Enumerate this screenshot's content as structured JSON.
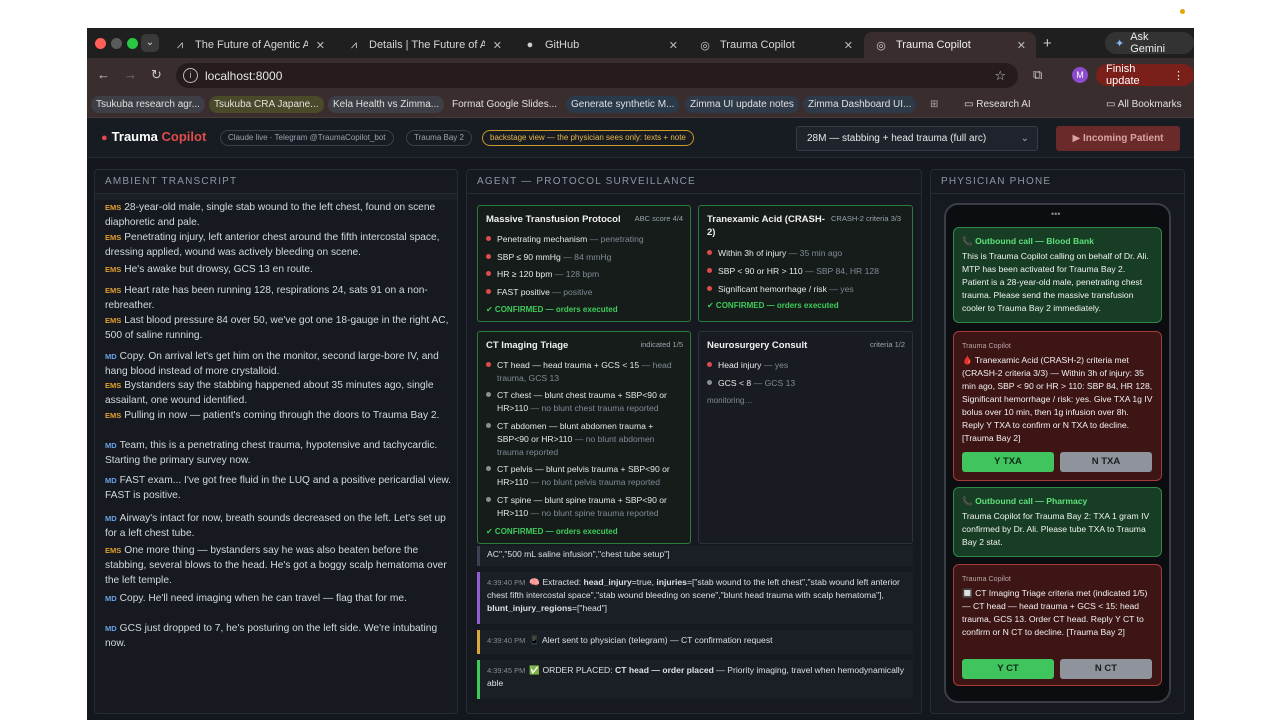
{
  "browser": {
    "tabs": [
      {
        "icon": "agent-icon",
        "title": "The Future of Agentic AI in H",
        "active": false
      },
      {
        "icon": "agent-icon",
        "title": "Details | The Future of Agent",
        "active": false
      },
      {
        "icon": "github-icon",
        "title": "GitHub",
        "active": false
      },
      {
        "icon": "globe-icon",
        "title": "Trauma Copilot",
        "active": false
      },
      {
        "icon": "globe-icon",
        "title": "Trauma Copilot",
        "active": true
      }
    ],
    "ask_gemini": "Ask Gemini",
    "url": "localhost:8000",
    "profile_initial": "M",
    "finish_update": "Finish update",
    "bookmarks": [
      "Tsukuba research agr...",
      "Tsukuba CRA Japane...",
      "Kela Health vs Zimma...",
      "Format Google Slides...",
      "Generate synthetic M...",
      "Zimma UI update notes",
      "Zimma Dashboard UI..."
    ],
    "bookmark_folder": "Research AI",
    "all_bookmarks": "All Bookmarks"
  },
  "header": {
    "brand_1": "Trauma",
    "brand_2": "Copilot",
    "pill_claude": "Claude live · Telegram @TraumaCopilot_bot",
    "pill_bay": "Trauma Bay 2",
    "pill_backstage": "backstage view — the physician sees only: texts + note",
    "scenario": "28M — stabbing + head trauma (full arc)",
    "incoming": "Incoming Patient"
  },
  "transcript": {
    "title": "AMBIENT TRANSCRIPT",
    "lines": [
      {
        "speaker": "EMS",
        "text": "28-year-old male, single stab wound to the left chest, found on scene diaphoretic and pale."
      },
      {
        "speaker": "EMS",
        "text": "Penetrating injury, left anterior chest around the fifth intercostal space, dressing applied, wound was actively bleeding on scene."
      },
      {
        "speaker": "EMS",
        "text": "He's awake but drowsy, GCS 13 en route."
      },
      {
        "speaker": "EMS",
        "text": "Heart rate has been running 128, respirations 24, sats 91 on a non-rebreather."
      },
      {
        "speaker": "EMS",
        "text": "Last blood pressure 84 over 50, we've got one 18-gauge in the right AC, 500 of saline running."
      },
      {
        "speaker": "MD",
        "text": "Copy. On arrival let's get him on the monitor, second large-bore IV, and hang blood instead of more crystalloid."
      },
      {
        "speaker": "EMS",
        "text": "Bystanders say the stabbing happened about 35 minutes ago, single assailant, one wound identified."
      },
      {
        "speaker": "EMS",
        "text": "Pulling in now — patient's coming through the doors to Trauma Bay 2."
      },
      {
        "speaker": "MD",
        "text": "Team, this is a penetrating chest trauma, hypotensive and tachycardic. Starting the primary survey now."
      },
      {
        "speaker": "MD",
        "text": "FAST exam... I've got free fluid in the LUQ and a positive pericardial view. FAST is positive."
      },
      {
        "speaker": "MD",
        "text": "Airway's intact for now, breath sounds decreased on the left. Let's set up for a left chest tube."
      },
      {
        "speaker": "EMS",
        "text": "One more thing — bystanders say he was also beaten before the stabbing, several blows to the head. He's got a boggy scalp hematoma over the left temple."
      },
      {
        "speaker": "MD",
        "text": "Copy. He'll need imaging when he can travel — flag that for me."
      },
      {
        "speaker": "MD",
        "text": "GCS just dropped to 7, he's posturing on the left side. We're intubating now."
      }
    ]
  },
  "agent": {
    "title": "AGENT — PROTOCOL SURVEILLANCE",
    "cards": [
      {
        "title": "Massive Transfusion Protocol",
        "score": "ABC score 4/4",
        "criteria": [
          {
            "label": "Penetrating mechanism",
            "note": "— penetrating"
          },
          {
            "label": "SBP ≤ 90 mmHg",
            "note": "— 84 mmHg"
          },
          {
            "label": "HR ≥ 120 bpm",
            "note": "— 128 bpm"
          },
          {
            "label": "FAST positive",
            "note": "— positive"
          }
        ],
        "status": "✔ CONFIRMED — orders executed"
      },
      {
        "title": "Tranexamic Acid (CRASH-2)",
        "score": "CRASH-2 criteria 3/3",
        "criteria": [
          {
            "label": "Within 3h of injury",
            "note": "— 35 min ago"
          },
          {
            "label": "SBP < 90 or HR > 110",
            "note": "— SBP 84, HR 128"
          },
          {
            "label": "Significant hemorrhage / risk",
            "note": "— yes"
          }
        ],
        "status": "✔ CONFIRMED — orders executed"
      },
      {
        "title": "CT Imaging Triage",
        "score": "indicated 1/5",
        "criteria": [
          {
            "label": "CT head — head trauma + GCS < 15",
            "note": "— head trauma, GCS 13"
          },
          {
            "label": "CT chest — blunt chest trauma + SBP<90 or HR>110",
            "note": "— no blunt chest trauma reported"
          },
          {
            "label": "CT abdomen — blunt abdomen trauma + SBP<90 or HR>110",
            "note": "— no blunt abdomen trauma reported"
          },
          {
            "label": "CT pelvis — blunt pelvis trauma + SBP<90 or HR>110",
            "note": "— no blunt pelvis trauma reported"
          },
          {
            "label": "CT spine — blunt spine trauma + SBP<90 or HR>110",
            "note": "— no blunt spine trauma reported"
          }
        ],
        "status": "✔ CONFIRMED — orders executed"
      },
      {
        "title": "Neurosurgery Consult",
        "score": "criteria 1/2",
        "criteria": [
          {
            "label": "Head injury",
            "note": "— yes"
          },
          {
            "label": "GCS < 8",
            "note": "— GCS 13"
          }
        ],
        "status": "monitoring…"
      }
    ],
    "log": [
      {
        "ts": "",
        "text": "AC\",\"500 mL saline infusion\",\"chest tube setup\"]"
      },
      {
        "ts": "4:39:40 PM",
        "pre": "🧠 Extracted: ",
        "k1": "head_injury",
        "t1": "=true, ",
        "k2": "injuries",
        "t2": "=[\"stab wound to the left chest\",\"stab wound left anterior chest fifth intercostal space\",\"stab wound bleeding on scene\",\"blunt head trauma with scalp hematoma\"], ",
        "k3": "blunt_injury_regions",
        "t3": "=[\"head\"]"
      },
      {
        "ts": "4:39:40 PM",
        "text": "📱 Alert sent to physician (telegram) — CT confirmation request"
      },
      {
        "ts": "4:39:45 PM",
        "pre": "✅ ORDER PLACED: ",
        "bold": "CT head — order placed",
        "text": " — Priority imaging, travel when hemodynamically able"
      }
    ]
  },
  "phone": {
    "title": "PHYSICIAN PHONE",
    "messages": [
      {
        "type": "call",
        "header": "📞 Outbound call — Blood Bank",
        "body": "This is Trauma Copilot calling on behalf of Dr. Ali. MTP has been activated for Trauma Bay 2. Patient is a 28-year-old male, penetrating chest trauma. Please send the massive transfusion cooler to Trauma Bay 2 immediately."
      },
      {
        "type": "alert",
        "sender": "Trauma Copilot",
        "body": "🩸 Tranexamic Acid (CRASH-2) criteria met (CRASH-2 criteria 3/3) — Within 3h of injury: 35 min ago, SBP < 90 or HR > 110: SBP 84, HR 128, Significant hemorrhage / risk: yes. Give TXA 1g IV bolus over 10 min, then 1g infusion over 8h. Reply Y TXA to confirm or N TXA to decline. [Trauma Bay 2]",
        "yes": "Y TXA",
        "no": "N TXA"
      },
      {
        "type": "call",
        "header": "📞 Outbound call — Pharmacy",
        "body": "Trauma Copilot for Trauma Bay 2: TXA 1 gram IV confirmed by Dr. Ali. Please tube TXA to Trauma Bay 2 stat."
      },
      {
        "type": "alert",
        "sender": "Trauma Copilot",
        "body": "🔲 CT Imaging Triage criteria met (indicated 1/5) — CT head — head trauma + GCS < 15: head trauma, GCS 13. Order CT head. Reply Y CT to confirm or N CT to decline. [Trauma Bay 2]",
        "yes": "Y CT",
        "no": "N CT"
      }
    ]
  },
  "colors": {
    "accent_red": "#e24b4b",
    "confirmed_green": "#3ecb5a",
    "ems_amber": "#e0a030",
    "md_blue": "#6aa3e8"
  }
}
